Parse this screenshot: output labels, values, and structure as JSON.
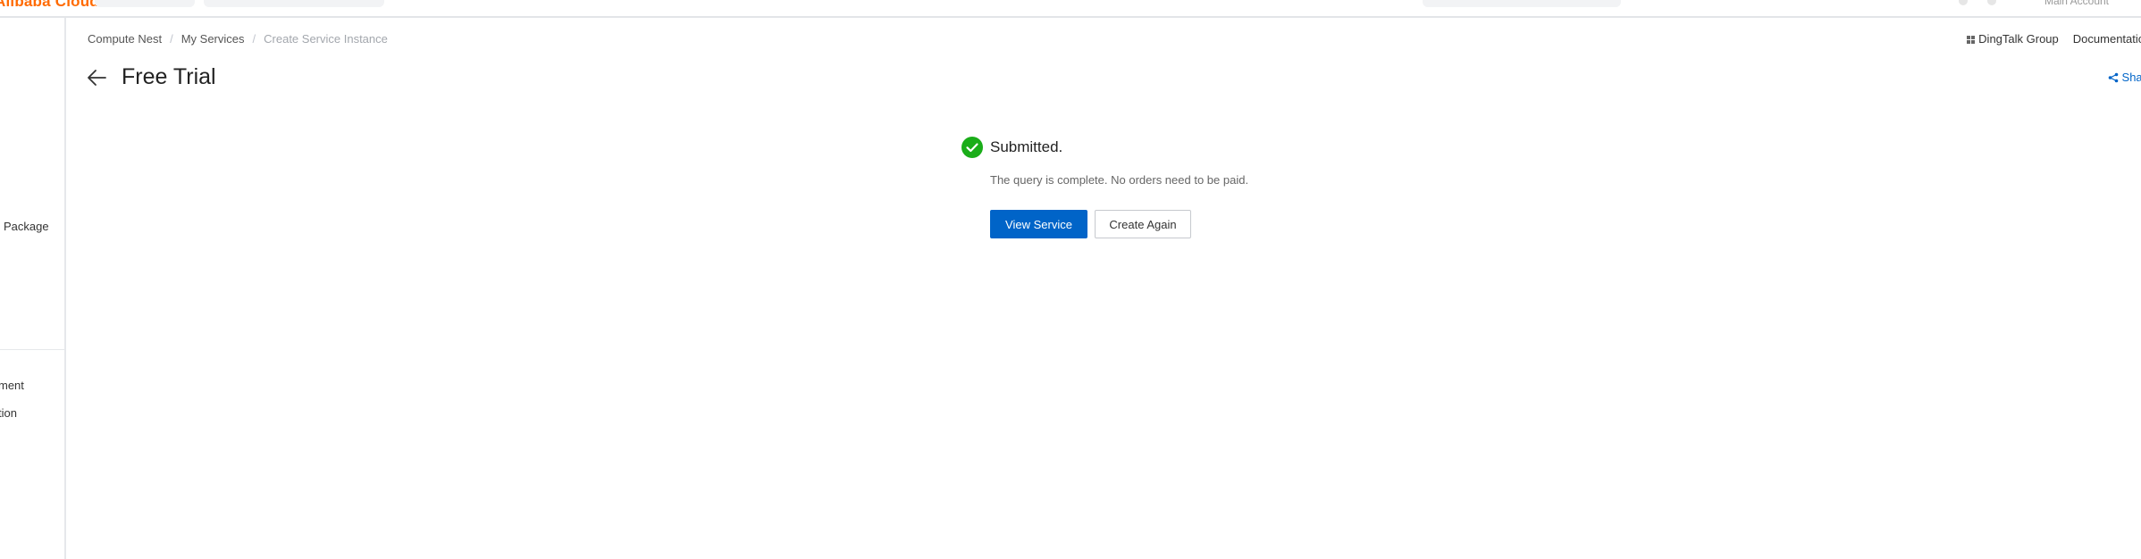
{
  "topbar": {
    "logo_text": "Alibaba Cloud",
    "account_label": "Main Account"
  },
  "sidebar": {
    "items": [
      {
        "label": "Package"
      },
      {
        "label": "ment"
      },
      {
        "label": "tion"
      }
    ]
  },
  "breadcrumb": {
    "items": [
      "Compute Nest",
      "My Services",
      "Create Service Instance"
    ],
    "separator": "/"
  },
  "header": {
    "title": "Free Trial",
    "dingtalk_label": "DingTalk Group",
    "documentation_label": "Documentatio",
    "share_label": "Shar"
  },
  "result": {
    "status": "success",
    "title": "Submitted.",
    "description": "The query is complete. No orders need to be paid.",
    "primary_button": "View Service",
    "secondary_button": "Create Again"
  },
  "colors": {
    "brand_orange": "#ff6a00",
    "primary_blue": "#0064c8",
    "success_green": "#1aad19"
  },
  "icons": {
    "back": "arrow-left-icon",
    "success": "check-circle-icon",
    "share": "share-icon",
    "dingtalk": "grid-icon"
  }
}
